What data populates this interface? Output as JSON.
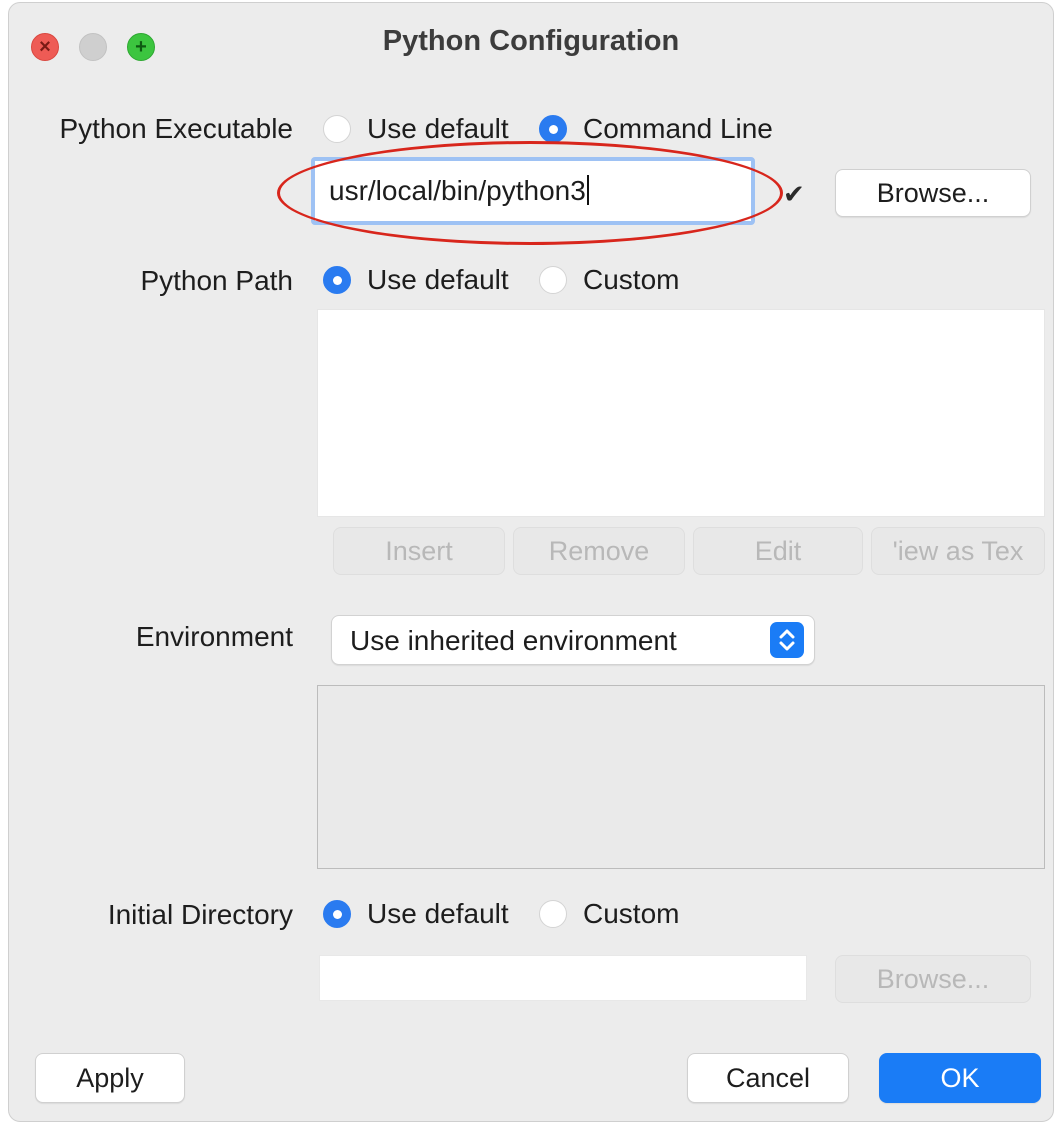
{
  "window": {
    "title": "Python Configuration",
    "controls": {
      "close_glyph": "×",
      "maximize_glyph": "+"
    }
  },
  "python_executable": {
    "label": "Python Executable",
    "options": [
      "Use default",
      "Command Line"
    ],
    "selected": "Command Line",
    "value": "usr/local/bin/python3",
    "dropdown_icon": "chevron-down-icon",
    "browse_label": "Browse..."
  },
  "python_path": {
    "label": "Python Path",
    "options": [
      "Use default",
      "Custom"
    ],
    "selected": "Use default",
    "entries": [],
    "buttons": {
      "insert": "Insert",
      "remove": "Remove",
      "edit": "Edit",
      "view_as_text": "'iew as Tex"
    }
  },
  "environment": {
    "label": "Environment",
    "selected": "Use inherited environment",
    "variables": []
  },
  "initial_directory": {
    "label": "Initial Directory",
    "options": [
      "Use default",
      "Custom"
    ],
    "selected": "Use default",
    "value": "",
    "browse_label": "Browse..."
  },
  "footer": {
    "apply": "Apply",
    "cancel": "Cancel",
    "ok": "OK"
  },
  "colors": {
    "accent": "#1a7cf6",
    "annotation": "#d8261c",
    "window_bg": "#ececec"
  }
}
